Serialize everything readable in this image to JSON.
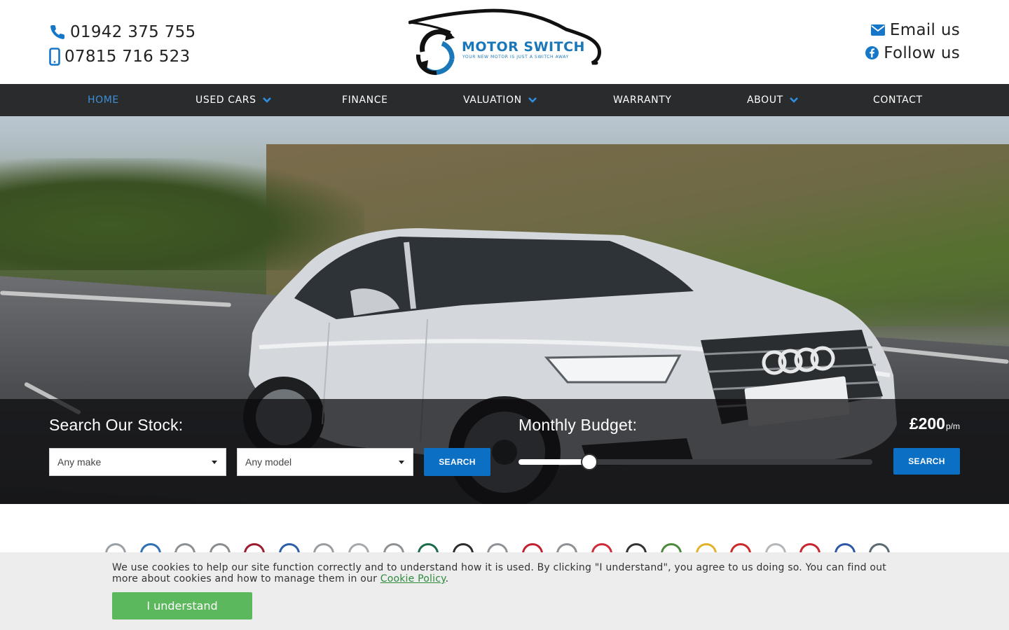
{
  "contact": {
    "phone_landline": "01942 375 755",
    "phone_mobile": "07815 716 523",
    "email_label": "Email us",
    "social_label": "Follow us"
  },
  "logo": {
    "name": "MOTOR SWITCH",
    "tagline": "YOUR NEW MOTOR IS JUST A SWITCH AWAY"
  },
  "nav": {
    "items": [
      {
        "label": "HOME",
        "active": true,
        "dropdown": false
      },
      {
        "label": "USED CARS",
        "active": false,
        "dropdown": true
      },
      {
        "label": "FINANCE",
        "active": false,
        "dropdown": false
      },
      {
        "label": "VALUATION",
        "active": false,
        "dropdown": true
      },
      {
        "label": "WARRANTY",
        "active": false,
        "dropdown": false
      },
      {
        "label": "ABOUT",
        "active": false,
        "dropdown": true
      },
      {
        "label": "CONTACT",
        "active": false,
        "dropdown": false
      }
    ]
  },
  "search": {
    "title": "Search Our Stock:",
    "make_value": "Any make",
    "model_value": "Any model",
    "button": "SEARCH"
  },
  "budget": {
    "title": "Monthly Budget:",
    "value": "£200",
    "unit": "p/m",
    "slider_level": 0.2,
    "button": "SEARCH"
  },
  "cookie": {
    "text": "We use cookies to help our site function correctly and to understand how it is used. By clicking \"I understand\", you agree to us doing so. You can find out more about cookies and how to manage them in our",
    "link": "Cookie Policy",
    "after_link": ".",
    "button": "I understand"
  },
  "brands": [
    "audi-logo",
    "bmw-logo",
    "citroen-logo",
    "dacia-logo",
    "fiat-logo",
    "ford-logo",
    "honda-logo",
    "hyundai-logo",
    "kia-logo",
    "land-rover-logo",
    "mazda-logo",
    "mercedes-logo",
    "mini-logo",
    "mitsubishi-logo",
    "nissan-logo",
    "peugeot-logo",
    "skoda-logo",
    "renault-logo",
    "seat-logo",
    "toyota-logo",
    "vauxhall-logo",
    "volkswagen-logo",
    "volvo-logo"
  ],
  "colors": {
    "accent": "#0b6fc4",
    "nav_bg": "#2a2b2d",
    "nav_active": "#3d8fd6",
    "cookie_button": "#5cb85c",
    "cookie_link": "#2e8b3e"
  }
}
